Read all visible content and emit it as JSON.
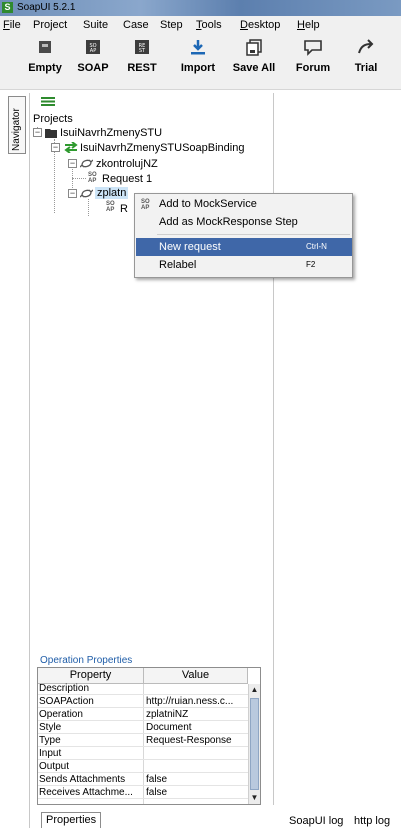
{
  "window": {
    "title": "SoapUI 5.2.1",
    "app_icon_letter": "S"
  },
  "menu": [
    {
      "label": "File",
      "mnemonic": "F",
      "rest": "ile"
    },
    {
      "label": "Project",
      "mnemonic": "",
      "rest": "Project"
    },
    {
      "label": "Suite",
      "mnemonic": "",
      "rest": "Suite"
    },
    {
      "label": "Case",
      "mnemonic": "",
      "rest": "Case"
    },
    {
      "label": "Step",
      "mnemonic": "",
      "rest": "Step"
    },
    {
      "label": "Tools",
      "mnemonic": "T",
      "rest": "ools"
    },
    {
      "label": "Desktop",
      "mnemonic": "D",
      "rest": "esktop"
    },
    {
      "label": "Help",
      "mnemonic": "H",
      "rest": "elp"
    }
  ],
  "toolbar": {
    "empty": "Empty",
    "soap": "SOAP",
    "rest": "REST",
    "import": "Import",
    "save_all": "Save All",
    "forum": "Forum",
    "trial": "Trial"
  },
  "navigator": {
    "tab_label": "Navigator"
  },
  "tree": {
    "root": "Projects",
    "project": "IsuiNavrhZmenySTU",
    "binding": "IsuiNavrhZmenySTUSoapBinding",
    "operation1": "zkontrolujNZ",
    "request1": "Request 1",
    "operation2": "zplatn",
    "request2_partial": "R"
  },
  "context_menu": {
    "items": [
      {
        "label": "Add to MockService",
        "shortcut": ""
      },
      {
        "label": "Add as MockResponse Step",
        "shortcut": ""
      },
      {
        "label": "New request",
        "shortcut": "Ctrl-N"
      },
      {
        "label": "Relabel",
        "shortcut": "F2"
      }
    ]
  },
  "operation_properties": {
    "title": "Operation Properties",
    "headers": [
      "Property",
      "Value"
    ],
    "rows": [
      [
        "Description",
        ""
      ],
      [
        "SOAPAction",
        "http://ruian.ness.c..."
      ],
      [
        "Operation",
        "zplatniNZ"
      ],
      [
        "Style",
        "Document"
      ],
      [
        "Type",
        "Request-Response"
      ],
      [
        "Input",
        ""
      ],
      [
        "Output",
        ""
      ],
      [
        "Sends Attachments",
        "false"
      ],
      [
        "Receives Attachme...",
        "false"
      ]
    ]
  },
  "bottom_tabs": {
    "properties": "Properties",
    "soapui_log": "SoapUI log",
    "http_log": "http log"
  },
  "colors": {
    "selection": "#3f67a8",
    "section_title": "#1f5da8"
  }
}
